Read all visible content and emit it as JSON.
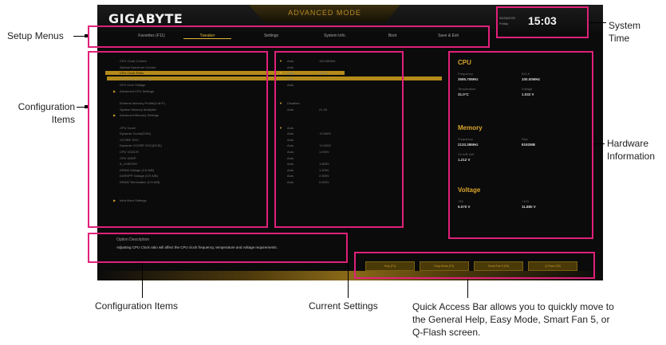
{
  "bios": {
    "brand": "GIGABYTE",
    "mode_title": "ADVANCED MODE",
    "date": "05/26/2020",
    "day": "Friday",
    "time": "15:03"
  },
  "menus": [
    {
      "label": "Favorites (F11)",
      "active": false
    },
    {
      "label": "Tweaker",
      "active": true
    },
    {
      "label": "Settings",
      "active": false
    },
    {
      "label": "System Info.",
      "active": false
    },
    {
      "label": "Boot",
      "active": false
    },
    {
      "label": "Save & Exit",
      "active": false
    }
  ],
  "config_items": [
    {
      "label": "CPU Clock Control",
      "arrow": false,
      "hl": false
    },
    {
      "label": "Spread Spectrum Control",
      "arrow": false,
      "hl": false
    },
    {
      "label": "CPU Clock Ratio",
      "arrow": false,
      "hl": true
    },
    {
      "label": "GFX Clock Frequency",
      "arrow": false,
      "hl": false
    },
    {
      "label": "GFX Core Voltage",
      "arrow": false,
      "hl": false
    },
    {
      "label": "Advanced CPU Settings",
      "arrow": true,
      "hl": false
    },
    {
      "label": "",
      "arrow": false,
      "hl": false
    },
    {
      "label": "Extreme Memory Profile(X.M.P.)",
      "arrow": false,
      "hl": false
    },
    {
      "label": "System Memory Multiplier",
      "arrow": false,
      "hl": false
    },
    {
      "label": "Advanced Memory Settings",
      "arrow": true,
      "hl": false
    },
    {
      "label": "",
      "arrow": false,
      "hl": false
    },
    {
      "label": "CPU Vcore",
      "arrow": false,
      "hl": false
    },
    {
      "label": "Dynamic Vcore(DVID)",
      "arrow": false,
      "hl": false
    },
    {
      "label": "VCORE SOC",
      "arrow": false,
      "hl": false
    },
    {
      "label": "Dynamic VCORE SOC(DVID)",
      "arrow": false,
      "hl": false
    },
    {
      "label": "CPU VDDCR",
      "arrow": false,
      "hl": false
    },
    {
      "label": "CPU VDDP",
      "arrow": false,
      "hl": false
    },
    {
      "label": "A_1V8STBY",
      "arrow": false,
      "hl": false
    },
    {
      "label": "DRAM Voltage (CH A/B)",
      "arrow": false,
      "hl": false
    },
    {
      "label": "DDRVPP Voltage (CH A/B)",
      "arrow": false,
      "hl": false
    },
    {
      "label": "DRAM Termination (CH A/B)",
      "arrow": false,
      "hl": false
    },
    {
      "label": "",
      "arrow": false,
      "hl": false
    },
    {
      "label": "",
      "arrow": false,
      "hl": false
    },
    {
      "label": "Infra Mem Settings",
      "arrow": true,
      "hl": false
    }
  ],
  "current_settings": [
    {
      "v1": "Auto",
      "v2": "100.00MHz",
      "mk": true
    },
    {
      "v1": "Auto",
      "v2": "",
      "mk": false
    },
    {
      "v1": "Auto",
      "v2": "36.00",
      "mk": true
    },
    {
      "v1": "Auto",
      "v2": "",
      "mk": false
    },
    {
      "v1": "Auto",
      "v2": "",
      "mk": false
    },
    {
      "v1": "",
      "v2": "",
      "mk": false
    },
    {
      "v1": "",
      "v2": "",
      "mk": false
    },
    {
      "v1": "Disabled",
      "v2": "",
      "mk": true
    },
    {
      "v1": "Auto",
      "v2": "21.33",
      "mk": false
    },
    {
      "v1": "",
      "v2": "",
      "mk": false
    },
    {
      "v1": "",
      "v2": "",
      "mk": false
    },
    {
      "v1": "Auto",
      "v2": "",
      "mk": true
    },
    {
      "v1": "Auto",
      "v2": "+0.000V",
      "mk": false
    },
    {
      "v1": "Auto",
      "v2": "",
      "mk": false
    },
    {
      "v1": "Auto",
      "v2": "+0.000V",
      "mk": false
    },
    {
      "v1": "Auto",
      "v2": "1.000V",
      "mk": false
    },
    {
      "v1": "Auto",
      "v2": "",
      "mk": false
    },
    {
      "v1": "Auto",
      "v2": "1.800V",
      "mk": false
    },
    {
      "v1": "Auto",
      "v2": "1.200V",
      "mk": false
    },
    {
      "v1": "Auto",
      "v2": "2.500V",
      "mk": false
    },
    {
      "v1": "Auto",
      "v2": "0.600V",
      "mk": false
    }
  ],
  "hardware": {
    "cpu_head": "CPU",
    "freq_lbl": "Frequency",
    "freq_val": "3595.70MHz",
    "bclk_lbl": "BCLK",
    "bclk_val": "100.00MHz",
    "temp_lbl": "Temperature",
    "temp_val": "31.0°C",
    "volt_lbl": "Voltage",
    "volt_val": "1.032 V",
    "mem_head": "Memory",
    "mfreq_lbl": "Frequency",
    "mfreq_val": "2133.38MHz",
    "size_lbl": "Size",
    "size_val": "8192MB",
    "chvolt_lbl": "Ch A/B Volt",
    "chvolt_val": "1.212 V",
    "volt_head": "Voltage",
    "v5_lbl": "+5V",
    "v5_val": "5.070 V",
    "v12_lbl": "+12V",
    "v12_val": "11.880 V"
  },
  "option": {
    "title": "Option Description",
    "text": "Adjusting CPU Clock ratio will affect the CPU clock frequency, temperature and voltage requirements."
  },
  "quick_access": [
    "Help (F1)",
    "Easy Mode (F2)",
    "Smart Fan 5 (F6)",
    "Q-Flash (F8)"
  ],
  "annotations": {
    "setup_menus": "Setup Menus",
    "system_time": "System\nTime",
    "config_left": "Configuration\nItems",
    "hardware_info": "Hardware\nInformation",
    "config_bottom": "Configuration Items",
    "current_settings": "Current Settings",
    "quick_access": "Quick Access Bar allows you to quickly move to\nthe General Help, Easy Mode, Smart Fan 5, or\nQ-Flash screen."
  }
}
